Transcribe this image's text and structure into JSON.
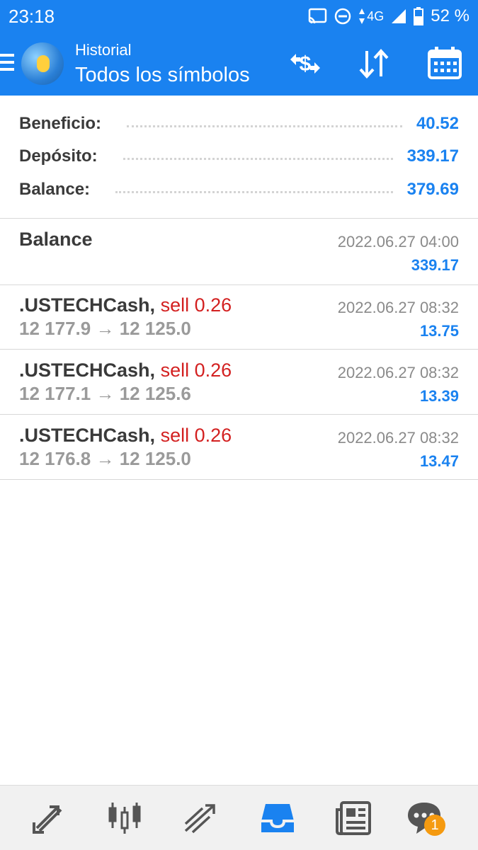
{
  "status_bar": {
    "time": "23:18",
    "network": "4G",
    "battery": "52 %",
    "icons": [
      "cast-icon",
      "do-not-disturb-icon",
      "data-arrows-icon",
      "signal-icon",
      "battery-icon"
    ]
  },
  "header": {
    "subtitle": "Historial",
    "title": "Todos los símbolos",
    "actions": [
      "currency-exchange-icon",
      "sort-icon",
      "calendar-icon"
    ],
    "accent_color": "#1a82f0"
  },
  "summary": {
    "profit_label": "Beneficio:",
    "profit_value": "40.52",
    "deposit_label": "Depósito:",
    "deposit_value": "339.17",
    "balance_label": "Balance:",
    "balance_value": "379.69"
  },
  "entries": [
    {
      "title": "Balance",
      "date": "2022.06.27 04:00",
      "amount": "339.17"
    },
    {
      "symbol": ".USTECHCash,",
      "side": "sell 0.26",
      "open_price": "12 177.9",
      "arrow": "→",
      "close_price": "12 125.0",
      "date": "2022.06.27 08:32",
      "amount": "13.75"
    },
    {
      "symbol": ".USTECHCash,",
      "side": "sell 0.26",
      "open_price": "12 177.1",
      "arrow": "→",
      "close_price": "12 125.6",
      "date": "2022.06.27 08:32",
      "amount": "13.39"
    },
    {
      "symbol": ".USTECHCash,",
      "side": "sell 0.26",
      "open_price": "12 176.8",
      "arrow": "→",
      "close_price": "12 125.0",
      "date": "2022.06.27 08:32",
      "amount": "13.47"
    }
  ],
  "bottom_nav": {
    "items": [
      "quotes-icon",
      "chart-icon",
      "trade-icon",
      "history-icon",
      "news-icon",
      "chat-icon"
    ],
    "active": "history-icon",
    "chat_badge": "1"
  },
  "colors": {
    "sell": "#d32020",
    "positive": "#1a82f0",
    "badge": "#f59a10"
  }
}
